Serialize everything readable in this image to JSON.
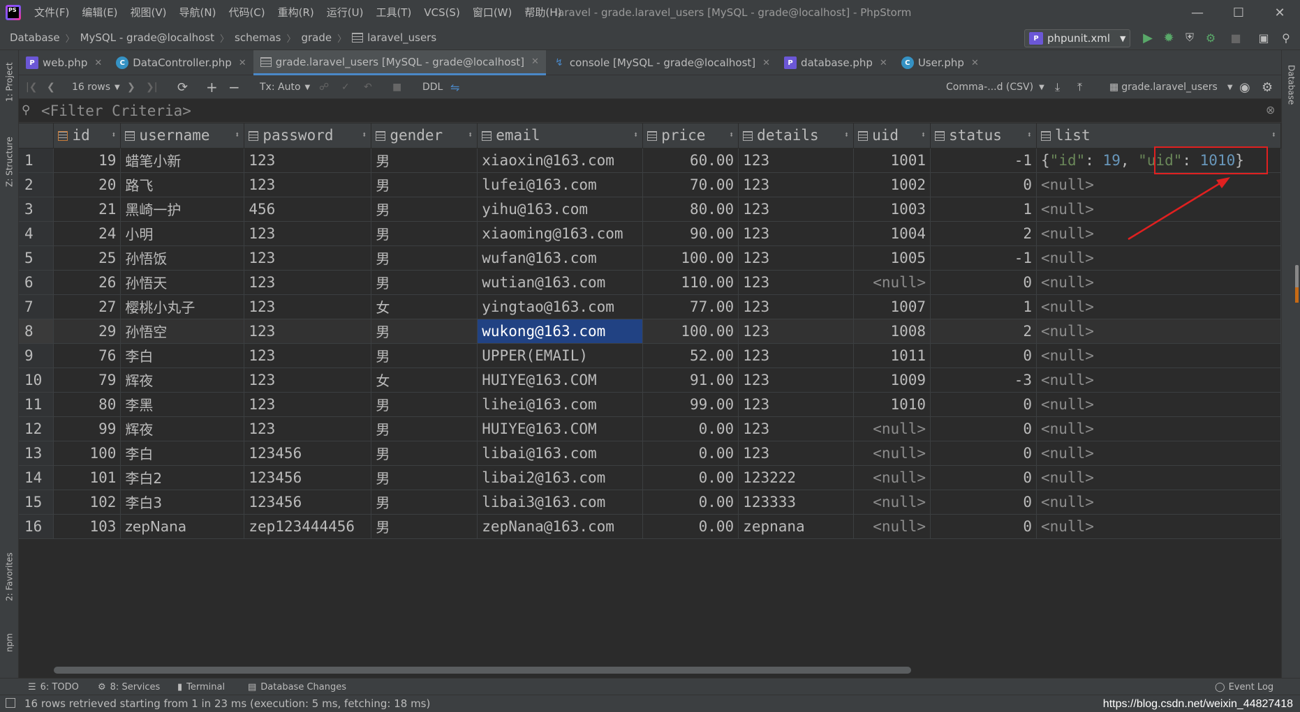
{
  "menubar": {
    "items": [
      "文件(F)",
      "编辑(E)",
      "视图(V)",
      "导航(N)",
      "代码(C)",
      "重构(R)",
      "运行(U)",
      "工具(T)",
      "VCS(S)",
      "窗口(W)",
      "帮助(H)"
    ],
    "window_title": "laravel - grade.laravel_users [MySQL - grade@localhost] - PhpStorm",
    "app_logo_text": "PS"
  },
  "breadcrumb": [
    "Database",
    "MySQL - grade@localhost",
    "schemas",
    "grade",
    "laravel_users"
  ],
  "run_config": "phpunit.xml",
  "tabs": [
    {
      "label": "web.php",
      "icon": "php-file-icon"
    },
    {
      "label": "DataController.php",
      "icon": "class-icon"
    },
    {
      "label": "grade.laravel_users [MySQL - grade@localhost]",
      "icon": "table-icon",
      "active": true
    },
    {
      "label": "console [MySQL - grade@localhost]",
      "icon": "console-icon"
    },
    {
      "label": "database.php",
      "icon": "php-file-icon"
    },
    {
      "label": "User.php",
      "icon": "class-icon"
    }
  ],
  "data_toolbar": {
    "rows": "16 rows",
    "tx": "Tx: Auto",
    "ddl": "DDL",
    "format": "Comma-...d (CSV)",
    "table_select": "grade.laravel_users"
  },
  "filter": {
    "placeholder": "<Filter Criteria>"
  },
  "grid": {
    "columns": [
      "id",
      "username",
      "password",
      "gender",
      "email",
      "price",
      "details",
      "uid",
      "status",
      "list"
    ],
    "null_text": "<null>",
    "rows": [
      {
        "n": "1",
        "id": "19",
        "username": "蜡笔小新",
        "password": "123",
        "gender": "男",
        "email": "xiaoxin@163.com",
        "price": "60.00",
        "details": "123",
        "uid": "1001",
        "status": "-1",
        "list": "{\"id\": 19, \"uid\": 1010}"
      },
      {
        "n": "2",
        "id": "20",
        "username": "路飞",
        "password": "123",
        "gender": "男",
        "email": "lufei@163.com",
        "price": "70.00",
        "details": "123",
        "uid": "1002",
        "status": "0",
        "list": null
      },
      {
        "n": "3",
        "id": "21",
        "username": "黑崎一护",
        "password": "456",
        "gender": "男",
        "email": "yihu@163.com",
        "price": "80.00",
        "details": "123",
        "uid": "1003",
        "status": "1",
        "list": null
      },
      {
        "n": "4",
        "id": "24",
        "username": "小明",
        "password": "123",
        "gender": "男",
        "email": "xiaoming@163.com",
        "price": "90.00",
        "details": "123",
        "uid": "1004",
        "status": "2",
        "list": null
      },
      {
        "n": "5",
        "id": "25",
        "username": "孙悟饭",
        "password": "123",
        "gender": "男",
        "email": "wufan@163.com",
        "price": "100.00",
        "details": "123",
        "uid": "1005",
        "status": "-1",
        "list": null
      },
      {
        "n": "6",
        "id": "26",
        "username": "孙悟天",
        "password": "123",
        "gender": "男",
        "email": "wutian@163.com",
        "price": "110.00",
        "details": "123",
        "uid": null,
        "status": "0",
        "list": null
      },
      {
        "n": "7",
        "id": "27",
        "username": "樱桃小丸子",
        "password": "123",
        "gender": "女",
        "email": "yingtao@163.com",
        "price": "77.00",
        "details": "123",
        "uid": "1007",
        "status": "1",
        "list": null
      },
      {
        "n": "8",
        "id": "29",
        "username": "孙悟空",
        "password": "123",
        "gender": "男",
        "email": "wukong@163.com",
        "price": "100.00",
        "details": "123",
        "uid": "1008",
        "status": "2",
        "list": null
      },
      {
        "n": "9",
        "id": "76",
        "username": "李白",
        "password": "123",
        "gender": "男",
        "email": "UPPER(EMAIL)",
        "price": "52.00",
        "details": "123",
        "uid": "1011",
        "status": "0",
        "list": null
      },
      {
        "n": "10",
        "id": "79",
        "username": "辉夜",
        "password": "123",
        "gender": "女",
        "email": "HUIYE@163.COM",
        "price": "91.00",
        "details": "123",
        "uid": "1009",
        "status": "-3",
        "list": null
      },
      {
        "n": "11",
        "id": "80",
        "username": "李黑",
        "password": "123",
        "gender": "男",
        "email": "lihei@163.com",
        "price": "99.00",
        "details": "123",
        "uid": "1010",
        "status": "0",
        "list": null
      },
      {
        "n": "12",
        "id": "99",
        "username": "辉夜",
        "password": "123",
        "gender": "男",
        "email": "HUIYE@163.COM",
        "price": "0.00",
        "details": "123",
        "uid": null,
        "status": "0",
        "list": null
      },
      {
        "n": "13",
        "id": "100",
        "username": "李白",
        "password": "123456",
        "gender": "男",
        "email": "libai@163.com",
        "price": "0.00",
        "details": "123",
        "uid": null,
        "status": "0",
        "list": null
      },
      {
        "n": "14",
        "id": "101",
        "username": "李白2",
        "password": "123456",
        "gender": "男",
        "email": "libai2@163.com",
        "price": "0.00",
        "details": "123222",
        "uid": null,
        "status": "0",
        "list": null
      },
      {
        "n": "15",
        "id": "102",
        "username": "李白3",
        "password": "123456",
        "gender": "男",
        "email": "libai3@163.com",
        "price": "0.00",
        "details": "123333",
        "uid": null,
        "status": "0",
        "list": null
      },
      {
        "n": "16",
        "id": "103",
        "username": "zepNana",
        "password": "zep123444456",
        "gender": "男",
        "email": "zepNana@163.com",
        "price": "0.00",
        "details": "zepnana",
        "uid": null,
        "status": "0",
        "list": null
      }
    ]
  },
  "json_cell": {
    "open": "{",
    "k1": "\"id\"",
    "sep1": ": ",
    "v1": "19",
    "comma": ", ",
    "k2": "\"uid\"",
    "sep2": ": ",
    "v2": "1010",
    "close": "}"
  },
  "left_stripe": [
    "1: Project",
    "Z: Structure",
    "2: Favorites",
    "npm"
  ],
  "right_stripe": [
    "Database"
  ],
  "bottom_tools": [
    "6: TODO",
    "8: Services",
    "Terminal",
    "Database Changes",
    "Event Log"
  ],
  "status": "16 rows retrieved starting from 1 in 23 ms (execution: 5 ms, fetching: 18 ms)",
  "watermark": "https://blog.csdn.net/weixin_44827418",
  "colors": {
    "accent": "#4a88c7",
    "selection": "#214283",
    "annotation": "#e02020"
  }
}
